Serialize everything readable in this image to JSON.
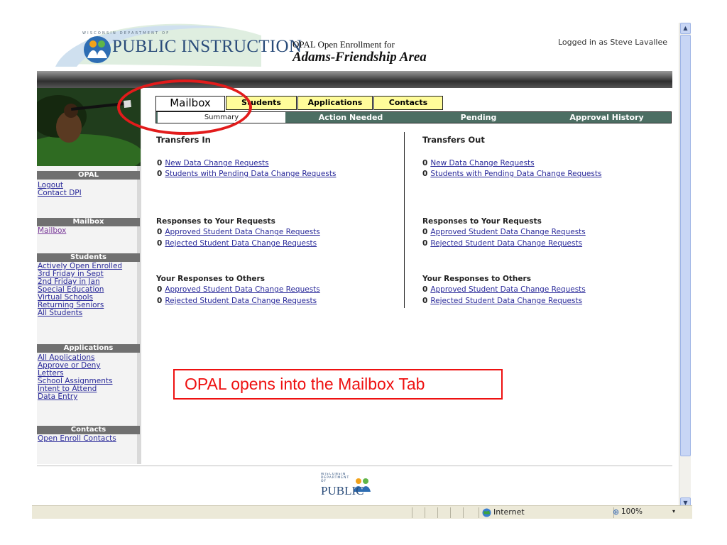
{
  "header": {
    "logo_small": "WISCONSIN DEPARTMENT OF",
    "logo_big": "PUBLIC INSTRUCTION",
    "line1": "OPAL Open Enrollment for",
    "line2": "Adams-Friendship Area",
    "logged_in": "Logged in as Steve Lavallee"
  },
  "sidebar": {
    "opal_head": "OPAL",
    "opal_links": [
      "Logout",
      "Contact DPI"
    ],
    "mailbox_head": "Mailbox",
    "mailbox_links": [
      "Mailbox"
    ],
    "students_head": "Students",
    "students_links": [
      "Actively Open Enrolled",
      "3rd Friday in Sept",
      "2nd Friday in Jan",
      "Special Education",
      "Virtual Schools",
      "Returning Seniors",
      "All Students"
    ],
    "applications_head": "Applications",
    "applications_links": [
      "All Applications",
      "Approve or Deny",
      "Letters",
      "School Assignments",
      "Intent to Attend",
      "Data Entry"
    ],
    "contacts_head": "Contacts",
    "contacts_links": [
      "Open Enroll Contacts"
    ]
  },
  "tabs": {
    "mailbox": "Mailbox",
    "students": "Students",
    "applications": "Applications",
    "contacts": "Contacts"
  },
  "subtabs": {
    "summary": "Summary",
    "action_needed": "Action Needed",
    "pending": "Pending",
    "approval_history": "Approval History"
  },
  "transfers_in": {
    "title": "Transfers In",
    "rows": [
      {
        "count": "0",
        "label": "New Data Change Requests"
      },
      {
        "count": "0",
        "label": "Students with Pending Data Change Requests"
      }
    ],
    "responses_head": "Responses to Your Requests",
    "responses": [
      {
        "count": "0",
        "label": "Approved Student Data Change Requests"
      },
      {
        "count": "0",
        "label": "Rejected Student Data Change Requests"
      }
    ],
    "your_responses_head": "Your Responses to Others",
    "your_responses": [
      {
        "count": "0",
        "label": "Approved Student Data Change Requests"
      },
      {
        "count": "0",
        "label": "Rejected Student Data Change Requests"
      }
    ]
  },
  "transfers_out": {
    "title": "Transfers Out",
    "rows": [
      {
        "count": "0",
        "label": "New Data Change Requests"
      },
      {
        "count": "0",
        "label": "Students with Pending Data Change Requests"
      }
    ],
    "responses_head": "Responses to Your Requests",
    "responses": [
      {
        "count": "0",
        "label": "Approved Student Data Change Requests"
      },
      {
        "count": "0",
        "label": "Rejected Student Data Change Requests"
      }
    ],
    "your_responses_head": "Your Responses to Others",
    "your_responses": [
      {
        "count": "0",
        "label": "Approved Student Data Change Requests"
      },
      {
        "count": "0",
        "label": "Rejected Student Data Change Requests"
      }
    ]
  },
  "callout": "OPAL opens into the Mailbox Tab",
  "footer": {
    "logo_small": "WISCONSIN DEPARTMENT OF",
    "logo_big": "PUBLIC INSTRUCTION"
  },
  "statusbar": {
    "zone": "Internet",
    "zoom": "100%"
  },
  "colors": {
    "tab_yellow": "#fffc9a",
    "subtab_green": "#4c6e63",
    "highlight_red": "#e21b1b",
    "link_blue": "#2a2a9a"
  }
}
